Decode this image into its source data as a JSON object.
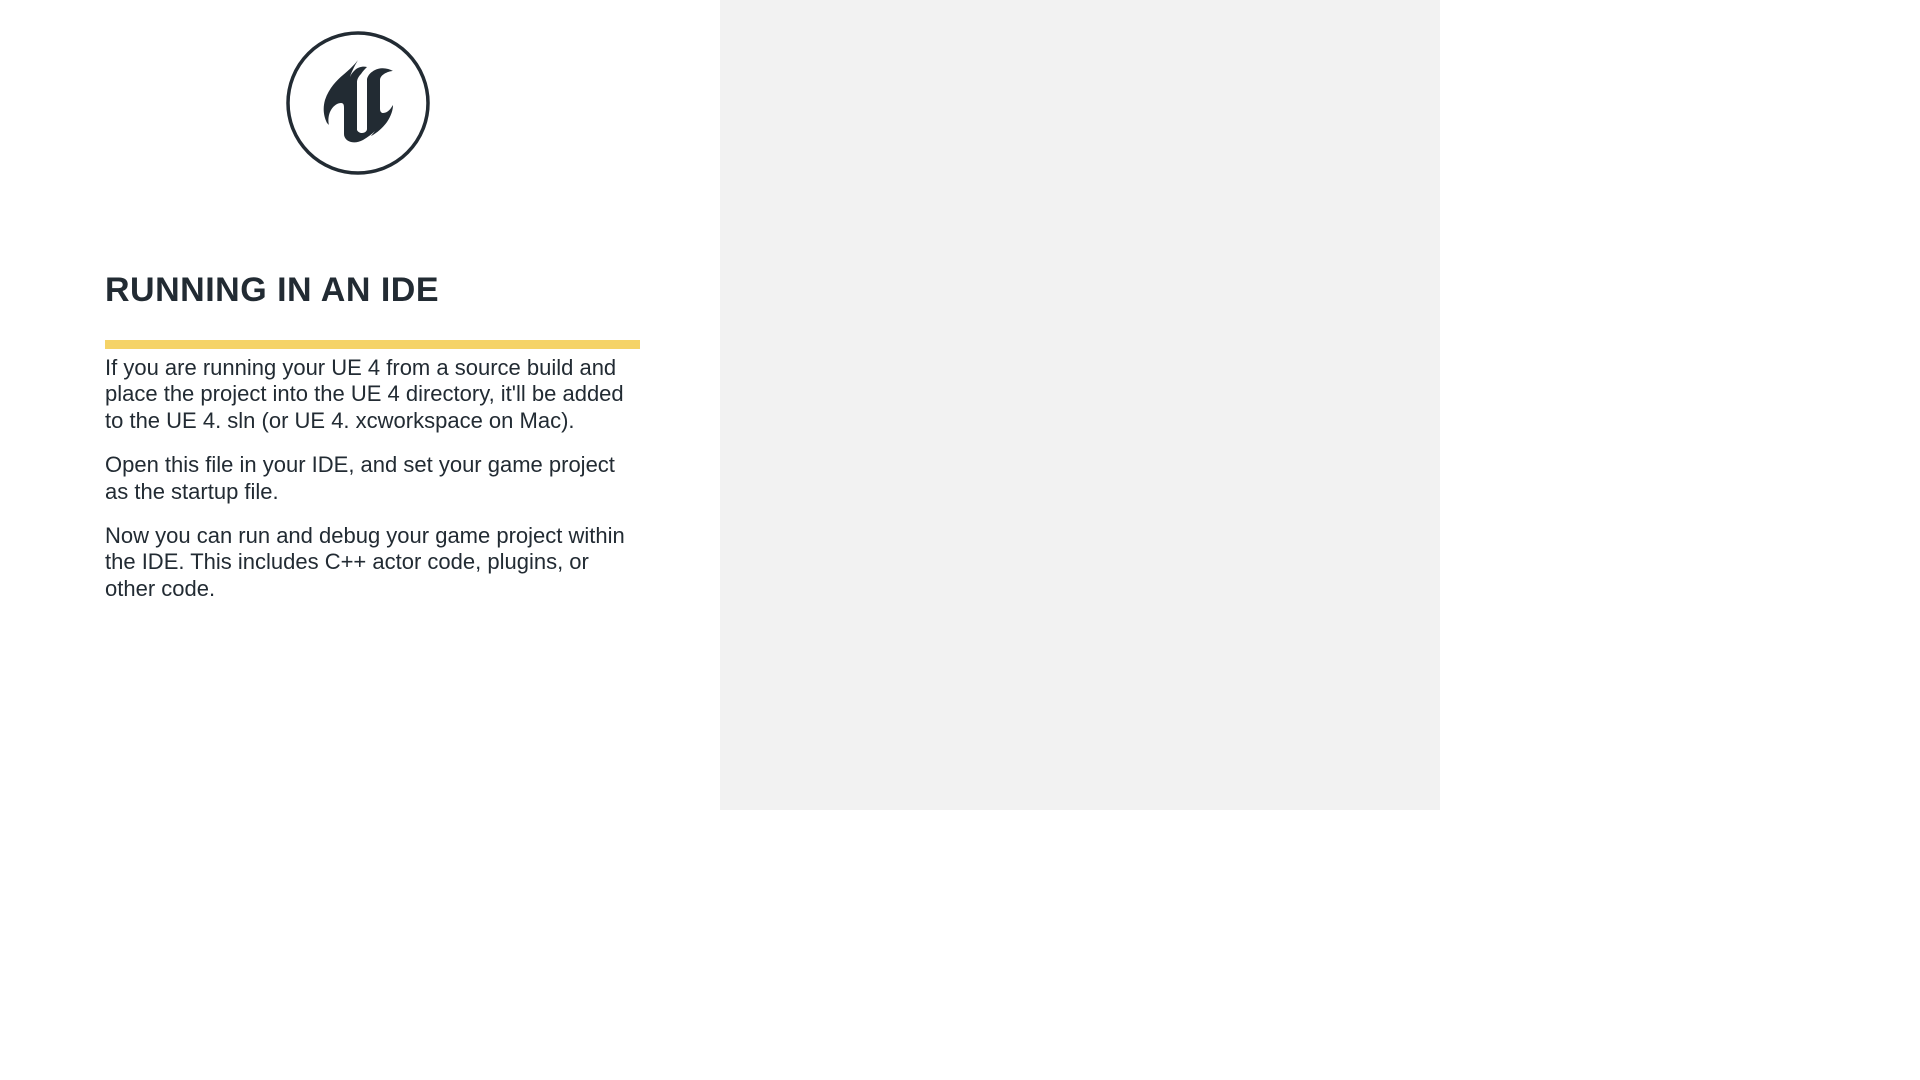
{
  "slide": {
    "title": "RUNNING IN AN IDE",
    "paragraphs": [
      "If you are running your UE 4 from a source build and place the project into the UE 4 directory, it'll be added to the UE 4. sln (or UE 4. xcworkspace on Mac).",
      "Open this file in your IDE, and set your game project as the startup file.",
      "Now you can run and debug your game project within the IDE. This includes C++ actor code, plugins, or other code."
    ]
  },
  "colors": {
    "accent": "#f5d367",
    "text": "#222b33",
    "panel_right": "#f2f2f2"
  }
}
